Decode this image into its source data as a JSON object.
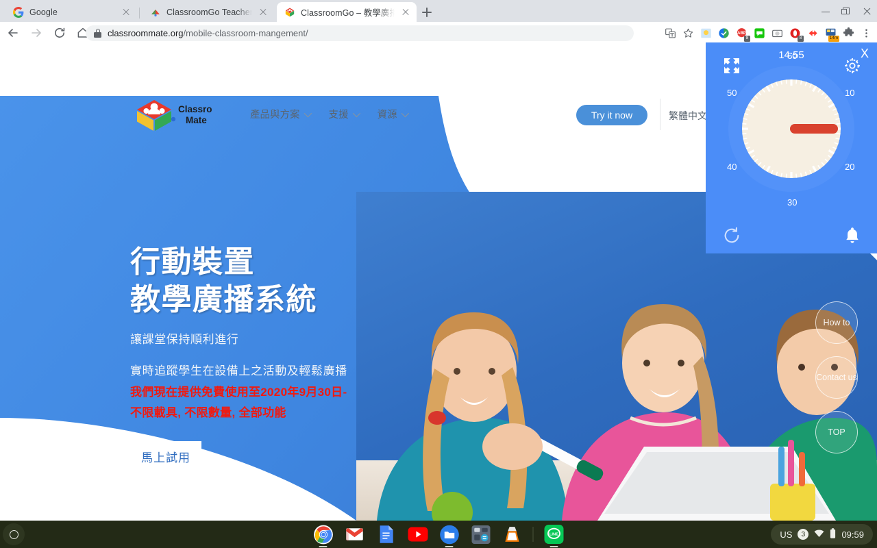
{
  "browser": {
    "tabs": [
      {
        "title": "Google",
        "favicon": "google-icon",
        "active": false
      },
      {
        "title": "ClassroomGo Teachers - Clas",
        "favicon": "classroomgo-icon",
        "active": false
      },
      {
        "title": "ClassroomGo – 教學廣播系統",
        "favicon": "classroommate-icon",
        "active": true
      }
    ],
    "new_tab_label": "+",
    "window_controls": {
      "minimize": "minimize-icon",
      "maximize": "maximize-icon",
      "close": "close-icon"
    },
    "nav": {
      "back": "back-arrow-icon",
      "forward": "forward-arrow-icon",
      "reload": "reload-icon",
      "home": "home-icon"
    },
    "omnibox": {
      "secure_icon": "lock-icon",
      "url_domain": "classroommate.org",
      "url_path": "/mobile-classroom-mangement/"
    },
    "toolbar_icons": [
      "translate-icon",
      "bookmark-star-icon",
      "weather-extension-icon",
      "tasks-extension-icon",
      "adblock-icon",
      "chat-extension-icon",
      "screenshot-extension-icon",
      "opera-vpn-icon",
      "speed-extension-icon",
      "timer-extension-icon",
      "extensions-puzzle-icon",
      "chrome-menu-icon"
    ],
    "adblock_badge": "8",
    "opera_badge": "8",
    "timer_badge": "14m"
  },
  "site": {
    "logo": {
      "name": "classroom-mate-logo",
      "line1": "Classroom",
      "line2": "Mate"
    },
    "nav_items": [
      {
        "label": "產品與方案",
        "has_dropdown": true
      },
      {
        "label": "支援",
        "has_dropdown": true
      },
      {
        "label": "資源",
        "has_dropdown": true
      }
    ],
    "try_button": "Try it now",
    "language": "繁體中文",
    "hero": {
      "title_line1": "行動裝置",
      "title_line2": "教學廣播系統",
      "sub_line1": "讓課堂保持順利進行",
      "sub_line2": "實時追蹤學生在設備上之活動及輕鬆廣播",
      "promo_line1": "我們現在提供免費使用至2020年9月30日-",
      "promo_line2": "不限載具, 不限數量, 全部功能",
      "cta": "馬上試用"
    },
    "floating_buttons": [
      {
        "label": "How to"
      },
      {
        "label": "Contact us"
      },
      {
        "label": "TOP"
      }
    ],
    "colors": {
      "brand_blue": "#4a90d9",
      "hero_blue": "#3f86e0",
      "promo_red": "#f01a10"
    }
  },
  "timer_widget": {
    "time": "14:55",
    "expand_icon": "expand-icon",
    "settings_icon": "gear-icon",
    "close_label": "X",
    "reset_icon": "reset-icon",
    "bell_icon": "bell-icon",
    "dial_labels": [
      "60",
      "10",
      "20",
      "30",
      "40",
      "50"
    ],
    "dial_face_color": "#f6efe2",
    "hand_color": "#d9422e",
    "background_color": "#4b8df8"
  },
  "shelf": {
    "launcher": "launcher-icon",
    "apps": [
      {
        "name": "chrome-app-icon",
        "running": true
      },
      {
        "name": "gmail-app-icon",
        "running": false
      },
      {
        "name": "google-docs-app-icon",
        "running": false
      },
      {
        "name": "youtube-app-icon",
        "running": false
      },
      {
        "name": "files-app-icon",
        "running": true
      },
      {
        "name": "calculator-app-icon",
        "running": false
      },
      {
        "name": "vlc-app-icon",
        "running": false
      },
      {
        "name": "line-app-icon",
        "running": true
      }
    ],
    "tray": {
      "keyboard_layout": "US",
      "notification_count": "3",
      "wifi_icon": "wifi-icon",
      "battery_icon": "battery-icon",
      "clock": "09:59"
    }
  }
}
